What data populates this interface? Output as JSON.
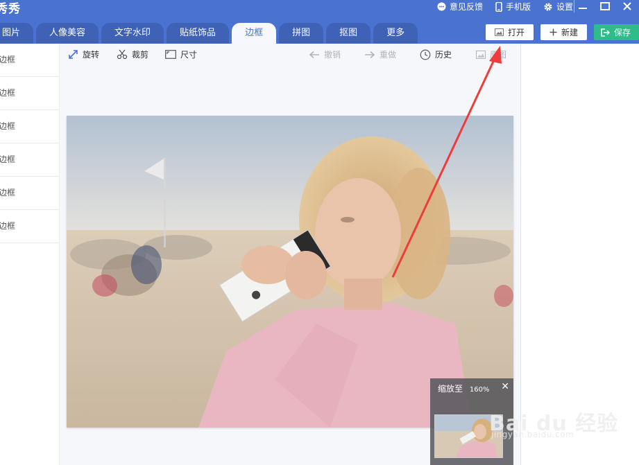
{
  "app": {
    "title": "秀秀"
  },
  "top_links": [
    {
      "label": "意见反馈",
      "icon": "feedback-icon"
    },
    {
      "label": "手机版",
      "icon": "mobile-icon"
    },
    {
      "label": "设置",
      "icon": "gear-icon"
    }
  ],
  "tabs": [
    {
      "label": "图片"
    },
    {
      "label": "人像美容"
    },
    {
      "label": "文字水印"
    },
    {
      "label": "贴纸饰品"
    },
    {
      "label": "边框",
      "active": true
    },
    {
      "label": "拼图"
    },
    {
      "label": "抠图"
    },
    {
      "label": "更多"
    }
  ],
  "actions": {
    "open": "打开",
    "new": "新建",
    "save": "保存"
  },
  "toolbar": {
    "rotate": "旋转",
    "crop": "裁剪",
    "size": "尺寸",
    "undo": "撤销",
    "redo": "重做",
    "history": "历史",
    "compare": "原图"
  },
  "sidebar": {
    "items": [
      "边框",
      "边框",
      "边框",
      "边框",
      "边框",
      "边框"
    ]
  },
  "zoom": {
    "label": "缩放至",
    "value": "160%"
  },
  "watermark": {
    "brand": "Bai du 经验",
    "url": "jingyan.baidu.com"
  },
  "colors": {
    "titlebar": "#4a73d1",
    "tab": "#3f62b7",
    "save": "#2ebd8a",
    "arrow": "#ee3b3b"
  }
}
